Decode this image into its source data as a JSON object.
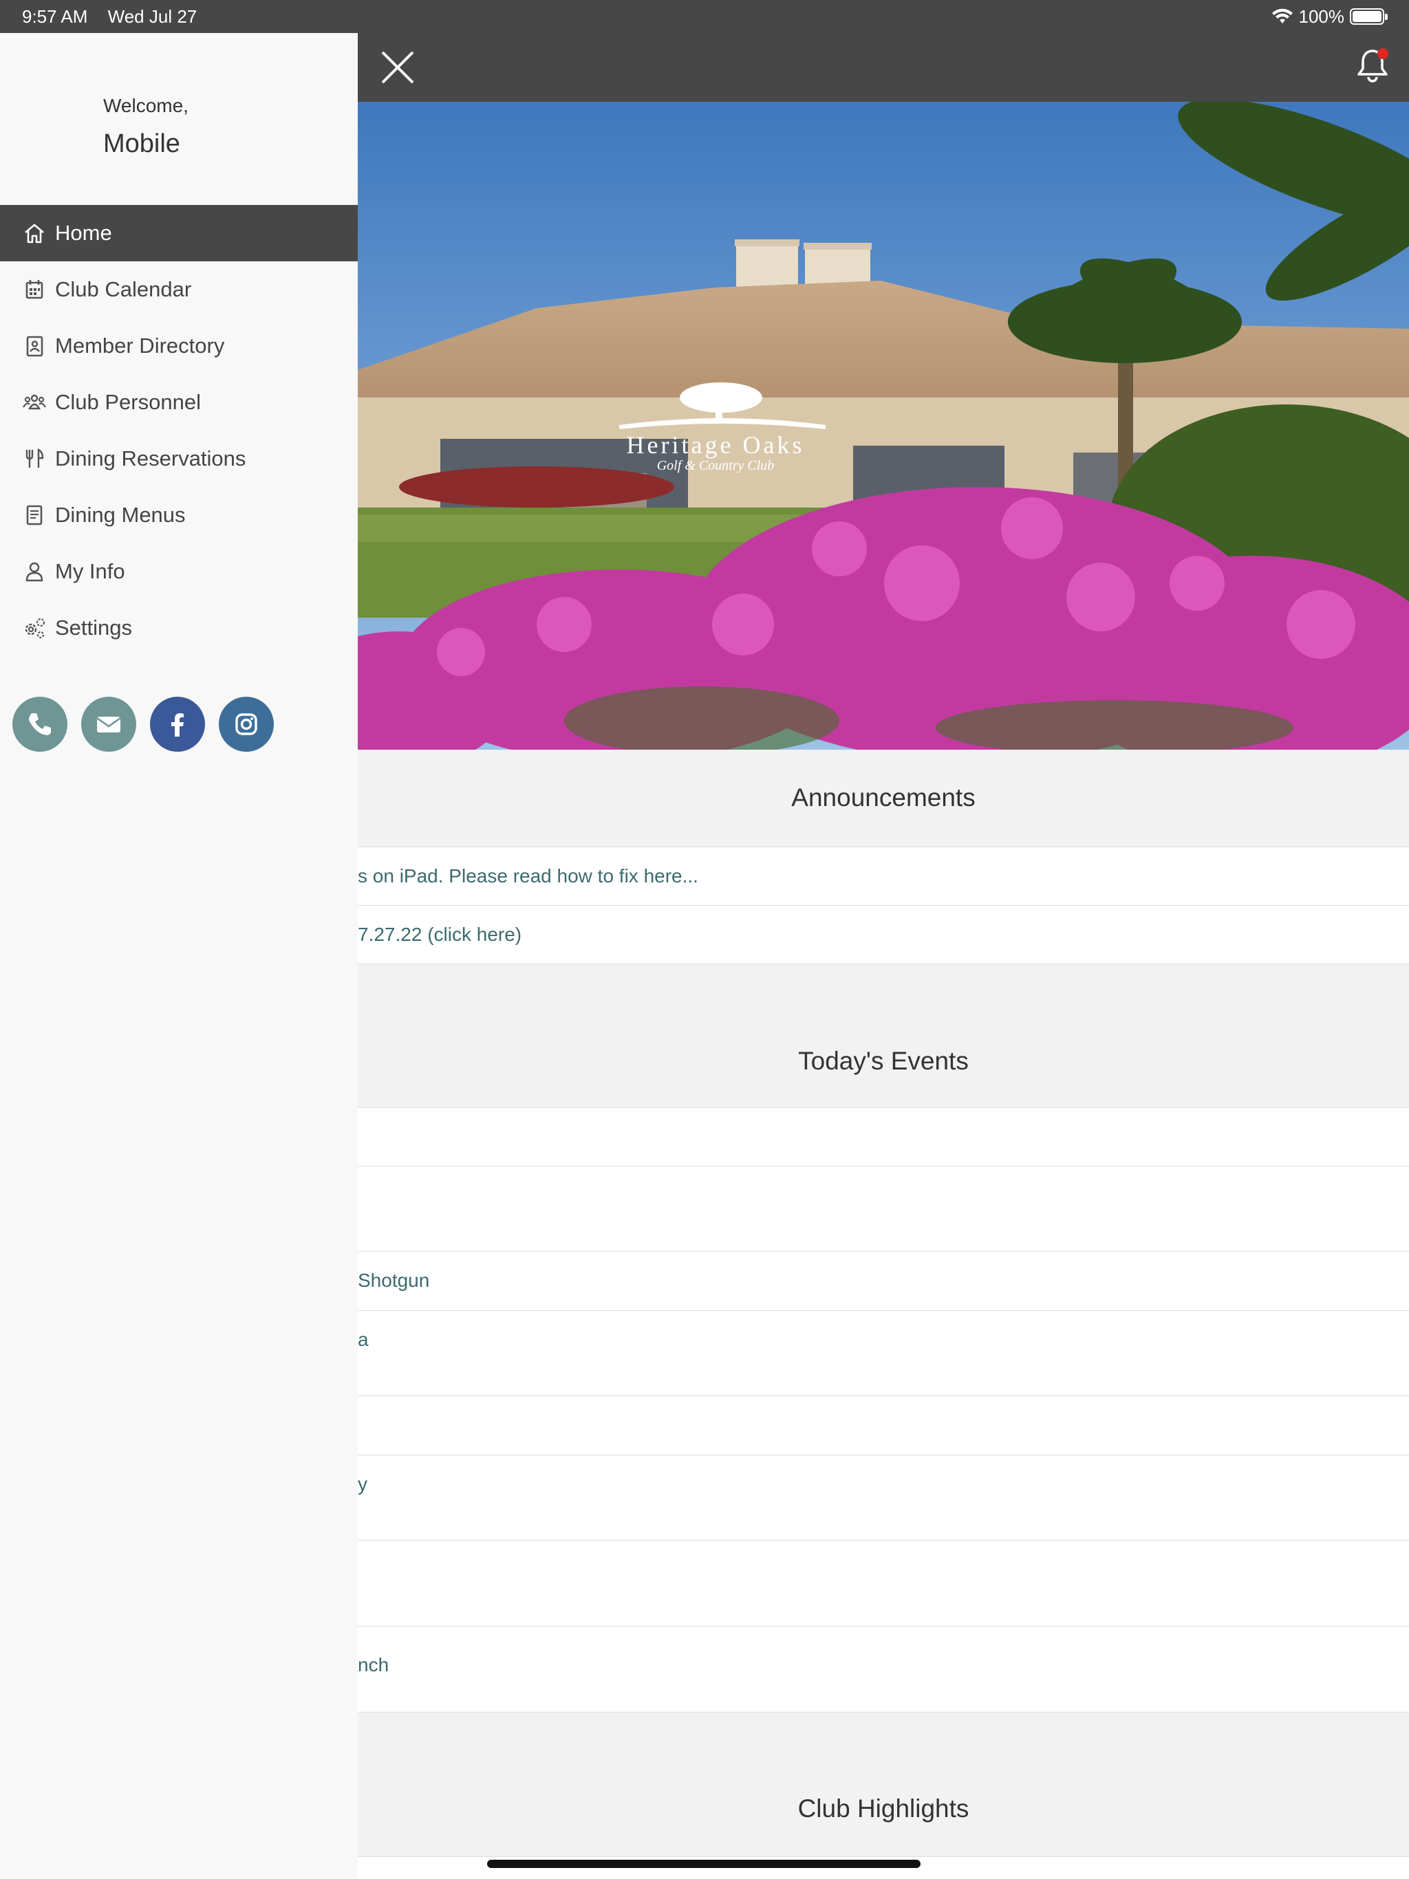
{
  "status_bar": {
    "time": "9:57 AM",
    "date": "Wed Jul 27",
    "battery": "100%"
  },
  "sidebar": {
    "welcome": "Welcome,",
    "user_name": "Mobile",
    "items": [
      {
        "label": "Home",
        "icon": "home-icon",
        "active": true
      },
      {
        "label": "Club Calendar",
        "icon": "calendar-icon"
      },
      {
        "label": "Member Directory",
        "icon": "contact-book-icon"
      },
      {
        "label": "Club Personnel",
        "icon": "people-icon"
      },
      {
        "label": "Dining Reservations",
        "icon": "utensils-icon"
      },
      {
        "label": "Dining Menus",
        "icon": "menu-book-icon"
      },
      {
        "label": "My Info",
        "icon": "person-icon"
      },
      {
        "label": "Settings",
        "icon": "gears-icon"
      }
    ],
    "social": [
      {
        "name": "phone-icon",
        "color": "#6f9595"
      },
      {
        "name": "email-icon",
        "color": "#6f9595"
      },
      {
        "name": "facebook-icon",
        "color": "#3b5998"
      },
      {
        "name": "instagram-icon",
        "color": "#3d6e99"
      }
    ]
  },
  "hero": {
    "brand_name": "Heritage Oaks",
    "brand_sub": "Golf & Country Club"
  },
  "announcements": {
    "title": "Announcements",
    "items": [
      "s on iPad. Please read how to fix here...",
      "7.27.22 (click here)"
    ]
  },
  "events": {
    "title": "Today's Events",
    "items": [
      "",
      "",
      "Shotgun",
      "a",
      "",
      "y",
      "",
      "nch"
    ]
  },
  "highlights": {
    "title": "Club Highlights"
  },
  "colors": {
    "topbar": "#474747",
    "link": "#3a6a6e",
    "section_bg": "#f2f2f2"
  }
}
